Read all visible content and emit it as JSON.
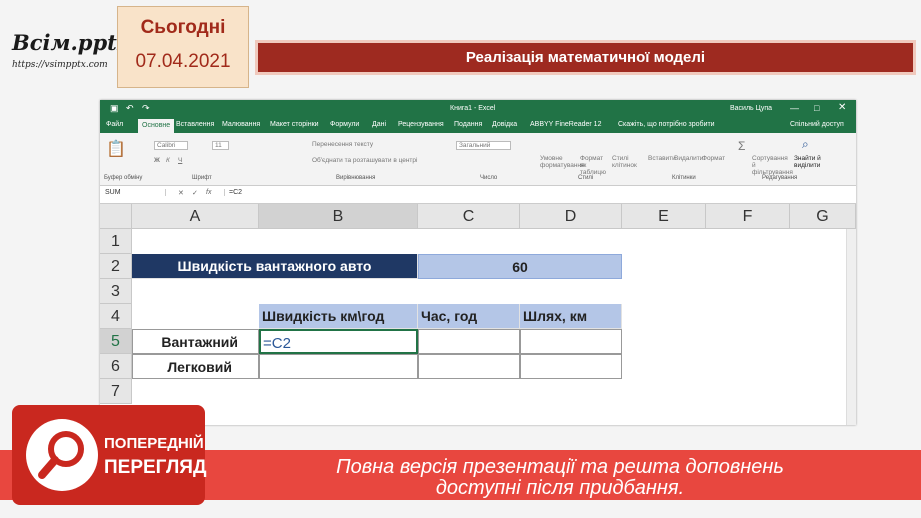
{
  "header": {
    "logo_main": "Всім.pptx",
    "logo_sub": "https://vsimpptx.com",
    "date_label": "Сьогодні",
    "date_value": "07.04.2021",
    "slide_title": "Реалізація математичної моделі"
  },
  "excel": {
    "window_title": "Книга1 - Excel",
    "user": "Василь Цупа",
    "menu": [
      "Файл",
      "Основне",
      "Вставлення",
      "Малювання",
      "Макет сторінки",
      "Формули",
      "Дані",
      "Рецензування",
      "Подання",
      "Довідка",
      "ABBYY FineReader 12",
      "Скажіть, що потрібно зробити",
      "Спільний доступ"
    ],
    "ribbon": {
      "font_name": "Calibri",
      "font_size": "11",
      "number_format": "Загальний",
      "items": [
        "Перенесення тексту",
        "Об'єднати та розташувати в центрі",
        "Умовне форматування",
        "Формат як таблицю",
        "Стилі клітинок",
        "Вставити",
        "Видалити",
        "Формат",
        "Сортування й фільтрування",
        "Знайти й виділити"
      ],
      "groups": [
        "Буфер обміну",
        "Шрифт",
        "Вирівнювання",
        "Число",
        "Стилі",
        "Клітинки",
        "Редагування"
      ]
    },
    "name_box": "SUM",
    "formula": "=C2",
    "columns": [
      "A",
      "B",
      "C",
      "D",
      "E",
      "F",
      "G"
    ],
    "rows": [
      "1",
      "2",
      "3",
      "4",
      "5",
      "6",
      "7"
    ],
    "cells": {
      "r2_title": "Швидкість вантажного авто",
      "r2_value": "60",
      "h_speed": "Швидкість км\\год",
      "h_time": "Час, год",
      "h_path": "Шлях, км",
      "r5_label": "Вантажний",
      "r5_b": "=C2",
      "r6_label": "Легковий"
    }
  },
  "banner": {
    "preview_line1": "ПОПЕРЕДНІЙ",
    "preview_line2": "ПЕРЕГЛЯД",
    "line1": "Повна версія презентації та решта доповнень",
    "line2": "доступні після придбання."
  },
  "colors": {
    "excel_green": "#217346",
    "title_red": "#9e2a20",
    "navy_cell": "#1f3864",
    "header_blue": "#b4c6e7",
    "banner_red": "#e8473f"
  }
}
